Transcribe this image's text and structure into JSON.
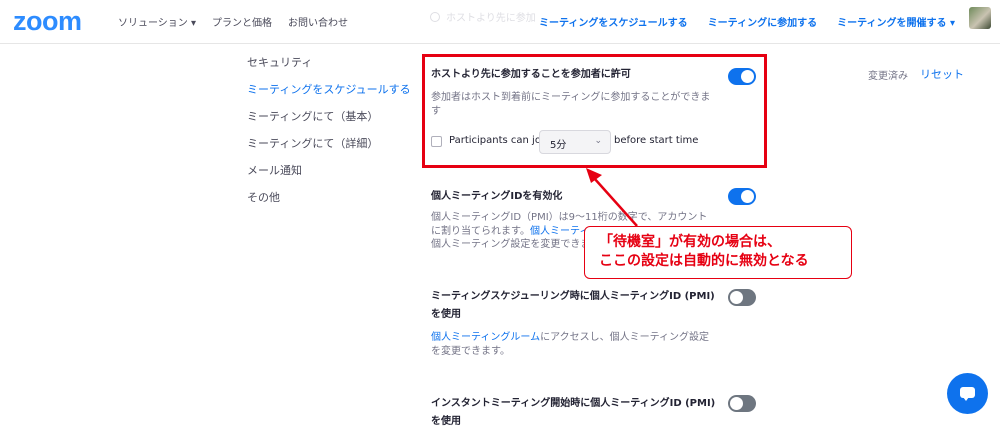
{
  "header": {
    "logo": "zoom",
    "nav_left": [
      "ソリューション ▾",
      "プランと価格",
      "お問い合わせ"
    ],
    "nav_right": [
      "ミーティングをスケジュールする",
      "ミーティングに参加する",
      "ミーティングを開催する ▾"
    ],
    "faded_option": "ホストより先に参加"
  },
  "sidebar": {
    "items": [
      {
        "label": "セキュリティ"
      },
      {
        "label": "ミーティングをスケジュールする"
      },
      {
        "label": "ミーティングにて（基本）"
      },
      {
        "label": "ミーティングにて（詳細）"
      },
      {
        "label": "メール通知"
      },
      {
        "label": "その他"
      }
    ]
  },
  "actions": {
    "changed": "変更済み",
    "reset": "リセット"
  },
  "settings": {
    "join_before_host": {
      "title": "ホストより先に参加することを参加者に許可",
      "desc_line1": "参加者はホスト到着前にミーティングに参加することができま",
      "desc_line2": "す",
      "enabled": true,
      "option_prefix": "Participants can join",
      "option_value": "5分",
      "option_suffix": "before start time"
    },
    "enable_pmi": {
      "title": "個人ミーティングIDを有効化",
      "desc_line1": "個人ミーティングID（PMI）は9～11桁の数字で、アカウント",
      "desc_line2_pre": "に割り当てられます。",
      "desc_line2_link": "個人ミーティ",
      "desc_line3": "個人ミーティング設定を変更できま",
      "enabled": true
    },
    "pmi_scheduling": {
      "title_line1": "ミーティングスケジューリング時に個人ミーティングID (PMI)",
      "title_line2": "を使用",
      "desc_link": "個人ミーティングルーム",
      "desc_rest": "にアクセスし、個人ミーティング設定",
      "desc_line2": "を変更できます。",
      "enabled": false
    },
    "pmi_instant": {
      "title_line1": "インスタントミーティング開始時に個人ミーティングID (PMI)",
      "title_line2": "を使用",
      "enabled": false
    }
  },
  "callout": {
    "line1": "「待機室」が有効の場合は、",
    "line2": "ここの設定は自動的に無効となる"
  },
  "colors": {
    "accent": "#0e72ed",
    "annotation_red": "#e60012"
  }
}
